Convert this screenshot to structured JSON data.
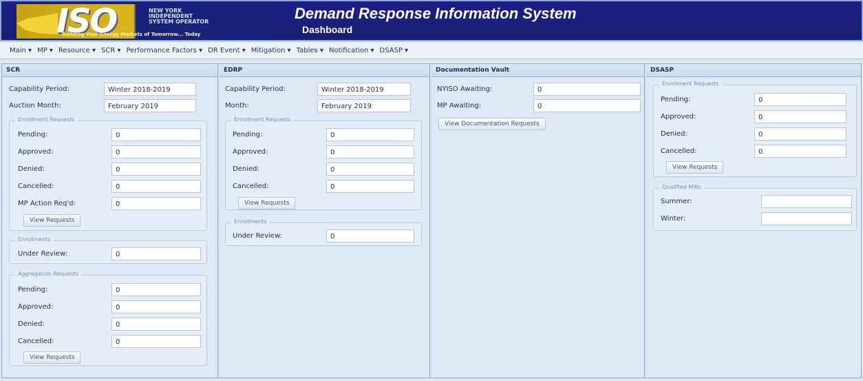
{
  "colors": {
    "header_bg": "#1c1f87",
    "logo_gold": "#dbb51c",
    "panel_bg": "#dfe9f5",
    "accent": "#8aa7c9"
  },
  "logo": {
    "iso": "ISO",
    "name": "NEW YORK INDEPENDENT SYSTEM OPERATOR",
    "tagline": "Building Your Energy Markets of Tomorrow... Today"
  },
  "header": {
    "title": "Demand Response Information System",
    "subtitle": "Dashboard"
  },
  "menu": [
    {
      "label": "Main ▾"
    },
    {
      "label": "MP ▾"
    },
    {
      "label": "Resource ▾"
    },
    {
      "label": "SCR ▾"
    },
    {
      "label": "Performance Factors ▾"
    },
    {
      "label": "DR Event ▾"
    },
    {
      "label": "Mitigation ▾"
    },
    {
      "label": "Tables ▾"
    },
    {
      "label": "Notification ▾"
    },
    {
      "label": "DSASP ▾"
    }
  ],
  "scr": {
    "header": "SCR",
    "capability_label": "Capability Period:",
    "capability_value": "Winter 2018-2019",
    "auction_label": "Auction Month:",
    "auction_value": "February 2019",
    "enrollment_title": "Enrollment Requests",
    "pending_label": "Pending:",
    "pending_value": "0",
    "approved_label": "Approved:",
    "approved_value": "0",
    "denied_label": "Denied:",
    "denied_value": "0",
    "cancelled_label": "Cancelled:",
    "cancelled_value": "0",
    "mp_action_label": "MP Action Req'd:",
    "mp_action_value": "0",
    "view_button": "View Requests",
    "enrollments_title": "Enrollments",
    "under_review_label": "Under Review:",
    "under_review_value": "0",
    "aggregation_title": "Aggregation Requests",
    "agg_pending_label": "Pending:",
    "agg_pending_value": "0",
    "agg_approved_label": "Approved:",
    "agg_approved_value": "0",
    "agg_denied_label": "Denied:",
    "agg_denied_value": "0",
    "agg_cancelled_label": "Cancelled:",
    "agg_cancelled_value": "0",
    "agg_view_button": "View Requests"
  },
  "edrp": {
    "header": "EDRP",
    "capability_label": "Capability Period:",
    "capability_value": "Winter 2018-2019",
    "month_label": "Month:",
    "month_value": "February 2019",
    "enrollment_title": "Enrollment Requests",
    "pending_label": "Pending:",
    "pending_value": "0",
    "approved_label": "Approved:",
    "approved_value": "0",
    "denied_label": "Denied:",
    "denied_value": "0",
    "cancelled_label": "Cancelled:",
    "cancelled_value": "0",
    "view_button": "View Requests",
    "enrollments_title": "Enrollments",
    "under_review_label": "Under Review:",
    "under_review_value": "0"
  },
  "docvault": {
    "header": "Documentation Vault",
    "nyiso_label": "NYISO Awaiting:",
    "nyiso_value": "0",
    "mp_label": "MP Awaiting:",
    "mp_value": "0",
    "view_button": "View Documentation Requests"
  },
  "dsasp": {
    "header": "DSASP",
    "enrollment_title": "Enrollment Requests",
    "pending_label": "Pending:",
    "pending_value": "0",
    "approved_label": "Approved:",
    "approved_value": "0",
    "denied_label": "Denied:",
    "denied_value": "0",
    "cancelled_label": "Cancelled:",
    "cancelled_value": "0",
    "view_button": "View Requests",
    "qualified_title": "Qualified MWs",
    "summer_label": "Summer:",
    "summer_value": "",
    "winter_label": "Winter:",
    "winter_value": ""
  }
}
